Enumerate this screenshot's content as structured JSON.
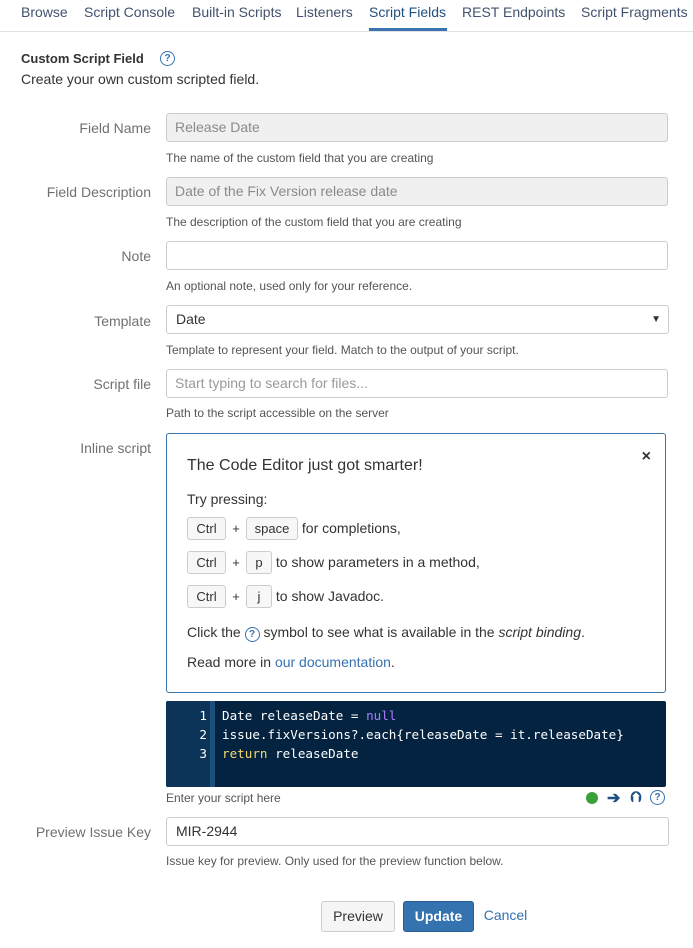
{
  "tabs": [
    {
      "label": "Browse"
    },
    {
      "label": "Script Console"
    },
    {
      "label": "Built-in Scripts"
    },
    {
      "label": "Listeners"
    },
    {
      "label": "Script Fields"
    },
    {
      "label": "REST Endpoints"
    },
    {
      "label": "Script Fragments"
    }
  ],
  "active_tab": "Script Fields",
  "header": {
    "title": "Custom Script Field",
    "subtitle": "Create your own custom scripted field.",
    "help_glyph": "?"
  },
  "form": {
    "field_name": {
      "label": "Field Name",
      "value": "Release Date",
      "hint": "The name of the custom field that you are creating"
    },
    "field_description": {
      "label": "Field Description",
      "value": "Date of the Fix Version release date",
      "hint": "The description of the custom field that you are creating"
    },
    "note": {
      "label": "Note",
      "value": "",
      "hint": "An optional note, used only for your reference."
    },
    "template": {
      "label": "Template",
      "value": "Date",
      "hint": "Template to represent your field. Match to the output of your script."
    },
    "script_file": {
      "label": "Script file",
      "placeholder": "Start typing to search for files...",
      "hint": "Path to the script accessible on the server"
    },
    "inline_script": {
      "label": "Inline script"
    },
    "preview_issue_key": {
      "label": "Preview Issue Key",
      "value": "MIR-2944",
      "hint": "Issue key for preview. Only used for the preview function below."
    }
  },
  "tip": {
    "title": "The Code Editor just got smarter!",
    "close": "×",
    "try": "Try pressing:",
    "shortcut_1": {
      "key1": "Ctrl",
      "plus": "+",
      "key2": "space",
      "text": "for completions,"
    },
    "shortcut_2": {
      "key1": "Ctrl",
      "plus": "+",
      "key2": "p",
      "text": "to show parameters in a method,"
    },
    "shortcut_3": {
      "key1": "Ctrl",
      "plus": "+",
      "key2": "j",
      "text": "to show Javadoc."
    },
    "binding_pre": "Click the",
    "binding_mid": "symbol to see what is available in the",
    "binding_em": "script binding",
    "binding_post": ".",
    "read_more": "Read more in",
    "doc_link": "our documentation",
    "doc_post": "."
  },
  "editor": {
    "line_numbers": [
      "1",
      "2",
      "3"
    ],
    "line1_a": "Date releaseDate = ",
    "line1_null": "null",
    "line2": "issue.fixVersions?.each{releaseDate = it.releaseDate}",
    "line3_return": "return",
    "line3_b": " releaseDate",
    "hint": "Enter your script here",
    "icons": [
      "status-ok-icon",
      "arrow-right-icon",
      "arrow-up-icon",
      "help-icon"
    ],
    "colors": {
      "background": "#042340",
      "gutter": "#0c3459",
      "null": "#a77cff",
      "return": "#f5d76e"
    }
  },
  "buttons": {
    "preview": "Preview",
    "update": "Update",
    "cancel": "Cancel"
  },
  "colors": {
    "accent": "#3572b0",
    "primary_button": "#3572b0",
    "active_tab": "#205081"
  }
}
